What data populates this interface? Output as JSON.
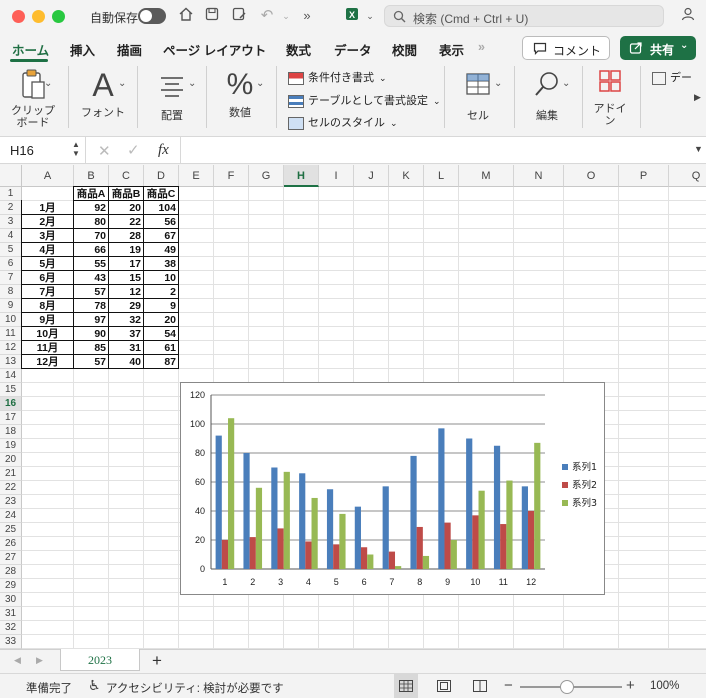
{
  "titlebar": {
    "autosave_label": "自動保存",
    "search_placeholder": "検索 (Cmd + Ctrl + U)"
  },
  "tabs": [
    "ホーム",
    "挿入",
    "描画",
    "ページ レイアウト",
    "数式",
    "データ",
    "校閲",
    "表示"
  ],
  "buttons": {
    "comment": "コメント",
    "share": "共有"
  },
  "ribbon": {
    "clipboard": "クリップボード",
    "font": "フォント",
    "align": "配置",
    "number": "数値",
    "cond_format": "条件付き書式",
    "table_format": "テーブルとして書式設定",
    "cell_style": "セルのスタイル",
    "cells": "セル",
    "edit": "編集",
    "addin": "アドイン",
    "data_partial": "デー"
  },
  "formula_bar": {
    "name_box": "H16",
    "fx": "fx"
  },
  "columns": [
    "A",
    "B",
    "C",
    "D",
    "E",
    "F",
    "G",
    "H",
    "I",
    "J",
    "K",
    "L",
    "M",
    "N",
    "O",
    "P",
    "Q"
  ],
  "selected_column": "H",
  "selected_row": 16,
  "table": {
    "headers": [
      "商品A",
      "商品B",
      "商品C"
    ],
    "rows": [
      {
        "month": "1月",
        "a": "92",
        "b": "20",
        "c": "104"
      },
      {
        "month": "2月",
        "a": "80",
        "b": "22",
        "c": "56"
      },
      {
        "month": "3月",
        "a": "70",
        "b": "28",
        "c": "67"
      },
      {
        "month": "4月",
        "a": "66",
        "b": "19",
        "c": "49"
      },
      {
        "month": "5月",
        "a": "55",
        "b": "17",
        "c": "38"
      },
      {
        "month": "6月",
        "a": "43",
        "b": "15",
        "c": "10"
      },
      {
        "month": "7月",
        "a": "57",
        "b": "12",
        "c": "2"
      },
      {
        "month": "8月",
        "a": "78",
        "b": "29",
        "c": "9"
      },
      {
        "month": "9月",
        "a": "97",
        "c": "20",
        "b": "32"
      },
      {
        "month": "10月",
        "a": "90",
        "b": "37",
        "c": "54"
      },
      {
        "month": "11月",
        "a": "85",
        "b": "31",
        "c": "61"
      },
      {
        "month": "12月",
        "a": "57",
        "b": "40",
        "c": "87"
      }
    ]
  },
  "chart_data": {
    "type": "bar",
    "categories": [
      "1",
      "2",
      "3",
      "4",
      "5",
      "6",
      "7",
      "8",
      "9",
      "10",
      "11",
      "12"
    ],
    "series": [
      {
        "name": "系列1",
        "color": "#4a7ebb",
        "values": [
          92,
          80,
          70,
          66,
          55,
          43,
          57,
          78,
          97,
          90,
          85,
          57
        ]
      },
      {
        "name": "系列2",
        "color": "#be4b48",
        "values": [
          20,
          22,
          28,
          19,
          17,
          15,
          12,
          29,
          32,
          37,
          31,
          40
        ]
      },
      {
        "name": "系列3",
        "color": "#98b954",
        "values": [
          104,
          56,
          67,
          49,
          38,
          10,
          2,
          9,
          20,
          54,
          61,
          87
        ]
      }
    ],
    "yticks": [
      "0",
      "20",
      "40",
      "60",
      "80",
      "100",
      "120"
    ],
    "ylim": [
      0,
      120
    ],
    "grid": true,
    "legend": "right"
  },
  "sheet": {
    "name": "2023",
    "add": "+"
  },
  "status": {
    "ready": "準備完了",
    "accessibility": "アクセシビリティ: 検討が必要です",
    "zoom": "100%"
  },
  "colors": {
    "accent": "#1e7145"
  }
}
